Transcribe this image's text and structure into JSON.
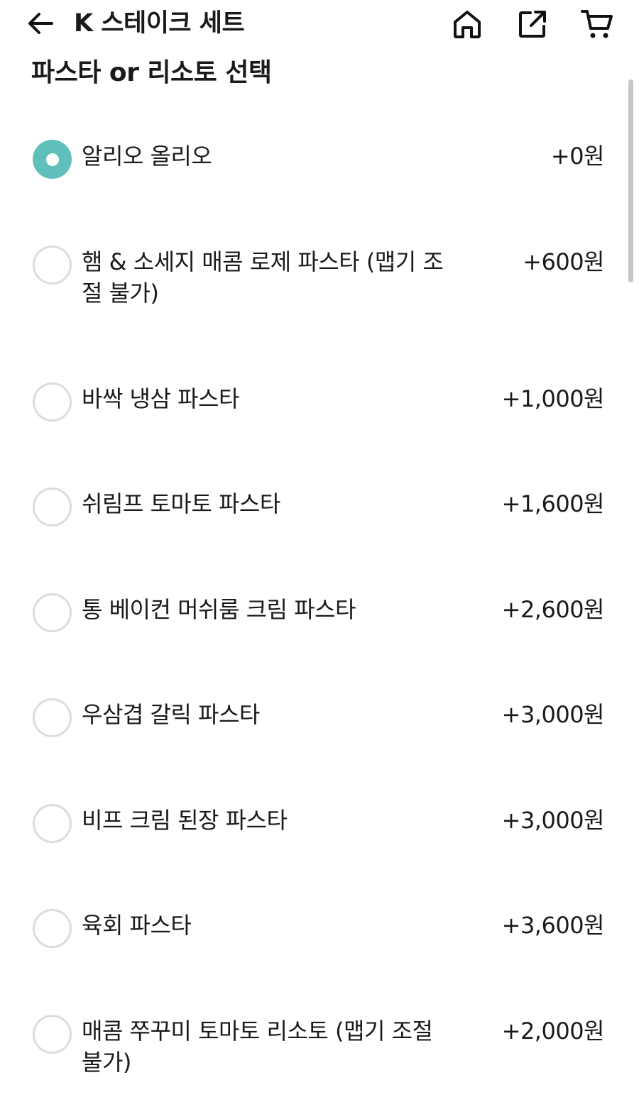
{
  "header": {
    "title": "K 스테이크 세트",
    "icons": [
      "back-arrow-icon",
      "home-icon",
      "share-icon",
      "cart-icon"
    ]
  },
  "section": {
    "title": "파스타 or 리소토 선택"
  },
  "colors": {
    "accent": "#5fbfbb",
    "radio_border": "#dcdcdc",
    "text": "#1a1a1a"
  },
  "options": [
    {
      "label": "알리오 올리오",
      "price": "+0원",
      "selected": true
    },
    {
      "label": "햄 & 소세지 매콤 로제 파스타 (맵기 조절 불가)",
      "price": "+600원",
      "selected": false
    },
    {
      "label": "바싹 냉삼 파스타",
      "price": "+1,000원",
      "selected": false
    },
    {
      "label": "쉬림프 토마토 파스타",
      "price": "+1,600원",
      "selected": false
    },
    {
      "label": "통 베이컨 머쉬룸 크림 파스타",
      "price": "+2,600원",
      "selected": false
    },
    {
      "label": "우삼겹 갈릭 파스타",
      "price": "+3,000원",
      "selected": false
    },
    {
      "label": "비프 크림 된장 파스타",
      "price": "+3,000원",
      "selected": false
    },
    {
      "label": "육회 파스타",
      "price": "+3,600원",
      "selected": false
    },
    {
      "label": "매콤 쭈꾸미 토마토 리소토 (맵기 조절 불가)",
      "price": "+2,000원",
      "selected": false
    }
  ]
}
